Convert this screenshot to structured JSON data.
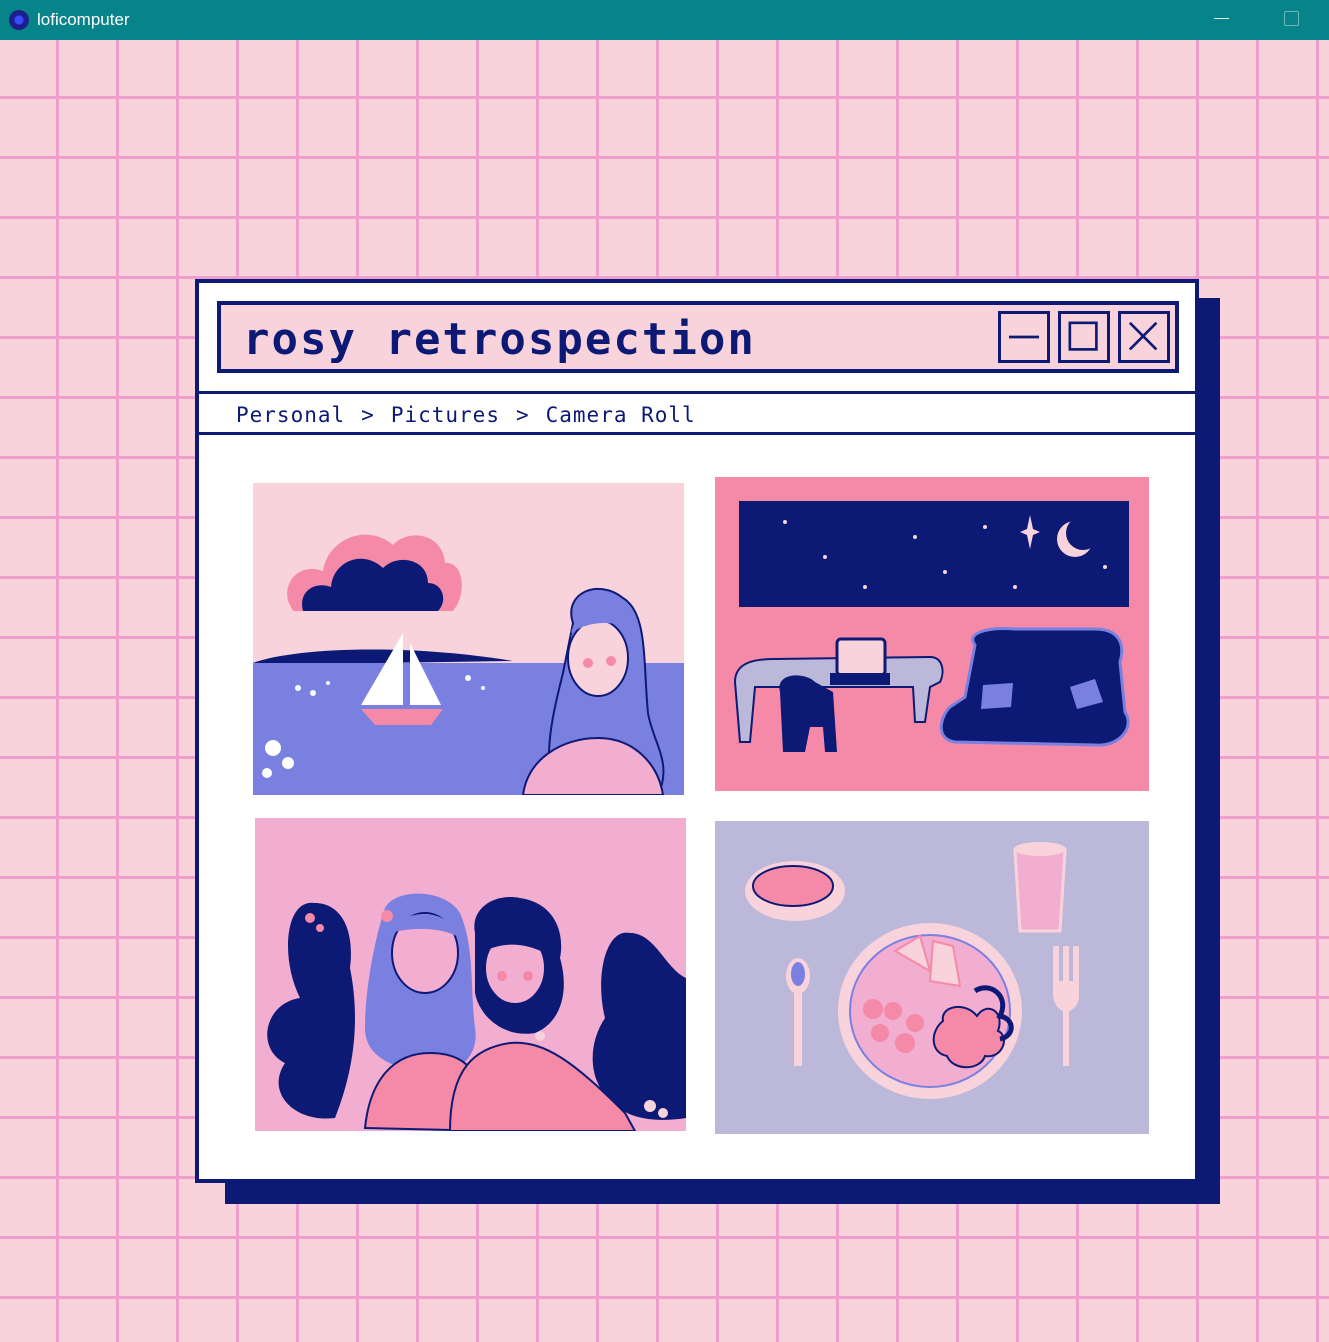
{
  "os_window": {
    "title": "loficomputer"
  },
  "retro_window": {
    "title": "rosy retrospection",
    "controls": [
      "minimize",
      "maximize",
      "close"
    ]
  },
  "breadcrumb": [
    "Personal",
    "Pictures",
    "Camera Roll"
  ],
  "breadcrumb_separator": ">",
  "gallery": [
    {
      "name": "sailboat-portrait",
      "icon": "woman-by-sea-image"
    },
    {
      "name": "night-room",
      "icon": "room-with-sofa-image"
    },
    {
      "name": "friends-hug",
      "icon": "two-friends-image"
    },
    {
      "name": "dinner-table",
      "icon": "meal-image"
    }
  ],
  "colors": {
    "navy": "#0d1a75",
    "pink_bg": "#f9d3dc",
    "grid": "#ee9fcb",
    "teal_bar": "#07838a",
    "rose": "#f48aa7",
    "periwinkle": "#7a80e0",
    "lavender": "#bbb8da"
  }
}
